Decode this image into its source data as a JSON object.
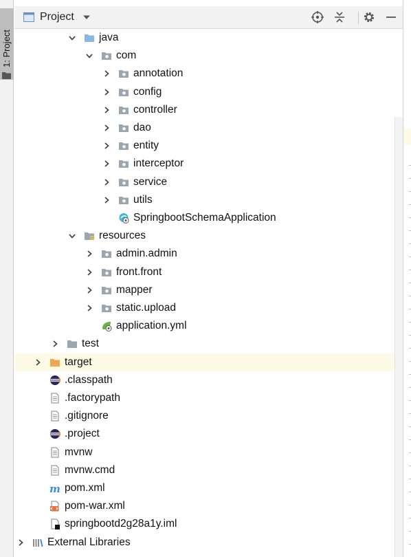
{
  "sidebar_tab": {
    "label": "1: Project"
  },
  "header": {
    "title": "Project"
  },
  "tree": [
    {
      "label": "java",
      "depth": 2,
      "icon": "source-folder",
      "arrow": "expanded"
    },
    {
      "label": "com",
      "depth": 3,
      "icon": "package-folder",
      "arrow": "expanded"
    },
    {
      "label": "annotation",
      "depth": 4,
      "icon": "package-folder",
      "arrow": "collapsed"
    },
    {
      "label": "config",
      "depth": 4,
      "icon": "package-folder",
      "arrow": "collapsed"
    },
    {
      "label": "controller",
      "depth": 4,
      "icon": "package-folder",
      "arrow": "collapsed"
    },
    {
      "label": "dao",
      "depth": 4,
      "icon": "package-folder",
      "arrow": "collapsed"
    },
    {
      "label": "entity",
      "depth": 4,
      "icon": "package-folder",
      "arrow": "collapsed"
    },
    {
      "label": "interceptor",
      "depth": 4,
      "icon": "package-folder",
      "arrow": "collapsed"
    },
    {
      "label": "service",
      "depth": 4,
      "icon": "package-folder",
      "arrow": "collapsed"
    },
    {
      "label": "utils",
      "depth": 4,
      "icon": "package-folder",
      "arrow": "collapsed"
    },
    {
      "label": "SpringbootSchemaApplication",
      "depth": 4,
      "icon": "spring-boot-class",
      "arrow": "none"
    },
    {
      "label": "resources",
      "depth": 2,
      "icon": "resources-folder",
      "arrow": "expanded"
    },
    {
      "label": "admin.admin",
      "depth": 3,
      "icon": "package-folder",
      "arrow": "collapsed"
    },
    {
      "label": "front.front",
      "depth": 3,
      "icon": "package-folder",
      "arrow": "collapsed"
    },
    {
      "label": "mapper",
      "depth": 3,
      "icon": "package-folder",
      "arrow": "collapsed"
    },
    {
      "label": "static.upload",
      "depth": 3,
      "icon": "package-folder",
      "arrow": "collapsed"
    },
    {
      "label": "application.yml",
      "depth": 3,
      "icon": "spring-config-file",
      "arrow": "none"
    },
    {
      "label": "test",
      "depth": 1,
      "icon": "gray-folder",
      "arrow": "collapsed"
    },
    {
      "label": "target",
      "depth": 0,
      "icon": "excluded-folder",
      "arrow": "collapsed",
      "highlight": true
    },
    {
      "label": ".classpath",
      "depth": 0,
      "icon": "eclipse-file",
      "arrow": "none"
    },
    {
      "label": ".factorypath",
      "depth": 0,
      "icon": "text-file",
      "arrow": "none"
    },
    {
      "label": ".gitignore",
      "depth": 0,
      "icon": "text-file",
      "arrow": "none"
    },
    {
      "label": ".project",
      "depth": 0,
      "icon": "eclipse-file",
      "arrow": "none"
    },
    {
      "label": "mvnw",
      "depth": 0,
      "icon": "text-file",
      "arrow": "none"
    },
    {
      "label": "mvnw.cmd",
      "depth": 0,
      "icon": "text-file",
      "arrow": "none"
    },
    {
      "label": "pom.xml",
      "depth": 0,
      "icon": "maven-file",
      "arrow": "none"
    },
    {
      "label": "pom-war.xml",
      "depth": 0,
      "icon": "xml-file",
      "arrow": "none"
    },
    {
      "label": "springbootd2g28a1y.iml",
      "depth": 0,
      "icon": "iml-file",
      "arrow": "none"
    },
    {
      "label": "External Libraries",
      "depth": -1,
      "icon": "libraries",
      "arrow": "collapsed"
    }
  ],
  "colors": {
    "folder_blue": "#87b7e3",
    "folder_gray": "#9aa7b0",
    "folder_orange": "#f0a550",
    "spring_green": "#62b543",
    "maven_blue": "#3d8fd1",
    "highlight_row": "#fdfbe6"
  }
}
